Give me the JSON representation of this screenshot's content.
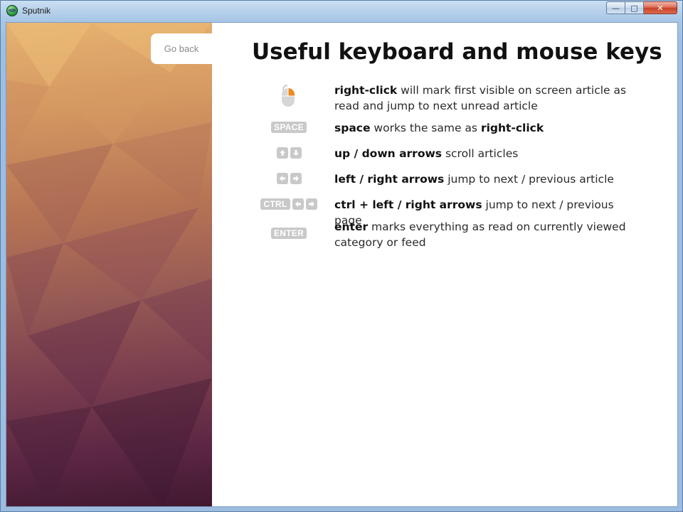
{
  "window": {
    "title": "Sputnik",
    "controls": {
      "minimize": "—",
      "maximize": "□",
      "close": "✕"
    }
  },
  "sidebar": {
    "go_back_label": "Go back"
  },
  "main": {
    "heading": "Useful keyboard and mouse keys",
    "shortcuts": [
      {
        "icon": "mouse-right-click-icon",
        "keys": [],
        "bold": "right-click",
        "text": " will mark first visible on screen article as read and jump to next unread article"
      },
      {
        "icon": "space-key-icon",
        "keys": [
          "SPACE"
        ],
        "bold": "space",
        "text": " works the same as ",
        "bold2": "right-click"
      },
      {
        "icon": "up-down-arrow-keys-icon",
        "keys": [
          "up",
          "down"
        ],
        "bold": "up / down arrows",
        "text": " scroll articles"
      },
      {
        "icon": "left-right-arrow-keys-icon",
        "keys": [
          "left",
          "right"
        ],
        "bold": "left / right arrows",
        "text": " jump to next / previous article"
      },
      {
        "icon": "ctrl-left-right-keys-icon",
        "keys": [
          "CTRL",
          "left",
          "right"
        ],
        "bold": "ctrl + left / right arrows",
        "text": " jump to next / previous page"
      },
      {
        "icon": "enter-key-icon",
        "keys": [
          "ENTER"
        ],
        "bold": "enter",
        "text": " marks everything as read on currently viewed category or feed"
      }
    ]
  },
  "colors": {
    "key_background": "#c9c9c9",
    "mouse_button_accent": "#f08a1c",
    "go_back_text": "#8a8a8a"
  }
}
